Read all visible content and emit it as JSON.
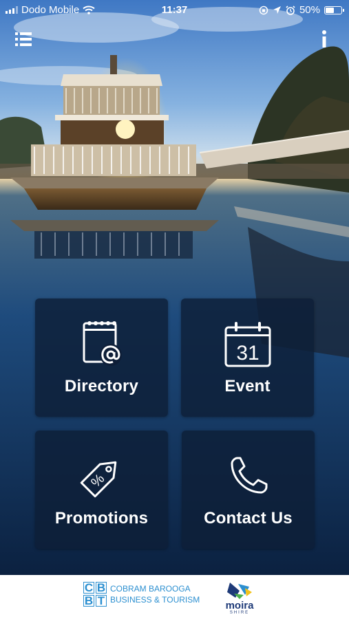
{
  "status_bar": {
    "carrier": "Dodo Mobile",
    "time": "11:37",
    "battery_level": "50%"
  },
  "header": {
    "menu_icon": "hamburger-list-icon",
    "info_icon": "info-icon"
  },
  "tiles": [
    {
      "label": "Directory",
      "icon": "contact-notebook-icon"
    },
    {
      "label": "Event",
      "icon": "calendar-icon",
      "icon_text": "31"
    },
    {
      "label": "Promotions",
      "icon": "price-tag-icon",
      "icon_text": "%"
    },
    {
      "label": "Contact Us",
      "icon": "phone-icon"
    }
  ],
  "footer": {
    "cbbt_logo": {
      "letters": [
        "C",
        "B",
        "B",
        "T"
      ],
      "line1": "COBRAM BAROOGA",
      "line2": "BUSINESS & TOURISM"
    },
    "moira_logo": {
      "name": "moira",
      "sub": "SHIRE"
    }
  },
  "colors": {
    "tile_background": "#0e1e37",
    "footer_background": "#ffffff",
    "cbbt_blue": "#2b8fd0",
    "moira_navy": "#1e3a78"
  }
}
